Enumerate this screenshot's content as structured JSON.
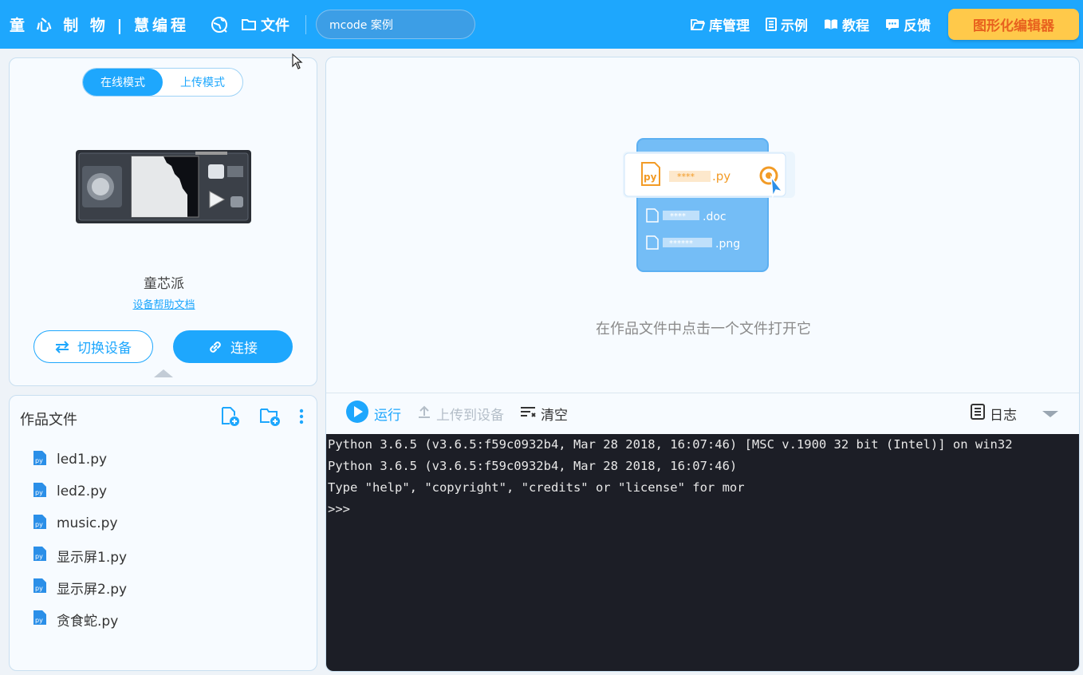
{
  "header": {
    "brand": "童 心 制 物 | 慧编程",
    "file_menu": "文件",
    "search_value": "mcode 案例",
    "nav": [
      {
        "label": "库管理",
        "icon": "folder-open-icon"
      },
      {
        "label": "示例",
        "icon": "list-doc-icon"
      },
      {
        "label": "教程",
        "icon": "book-icon"
      },
      {
        "label": "反馈",
        "icon": "chat-icon"
      }
    ],
    "graphic_editor": "图形化编辑器"
  },
  "device": {
    "modes": [
      "在线模式",
      "上传模式"
    ],
    "active_mode": "在线模式",
    "name": "童芯派",
    "help_link": "设备帮助文档",
    "switch_label": "切换设备",
    "connect_label": "连接"
  },
  "files": {
    "title": "作品文件",
    "items": [
      "led1.py",
      "led2.py",
      "music.py",
      "显示屏1.py",
      "显示屏2.py",
      "贪食蛇.py"
    ]
  },
  "editor": {
    "illustration": {
      "py_mask": "****",
      "py_ext": ".py",
      "doc_mask": "****",
      "doc_ext": ".doc",
      "png_mask": "******",
      "png_ext": ".png"
    },
    "empty_hint": "在作品文件中点击一个文件打开它"
  },
  "console": {
    "run_label": "运行",
    "upload_label": "上传到设备",
    "clear_label": "清空",
    "log_label": "日志",
    "lines": [
      "Python 3.6.5 (v3.6.5:f59c0932b4, Mar 28 2018, 16:07:46) [MSC v.1900 32 bit (Intel)] on win32",
      "Python 3.6.5 (v3.6.5:f59c0932b4, Mar 28 2018, 16:07:46)",
      "Type \"help\", \"copyright\", \"credits\" or \"license\" for mor",
      ">>>"
    ]
  },
  "colors": {
    "primary": "#1ea7fd",
    "accent_button": "#ffc94a",
    "accent_text": "#e8611e",
    "terminal_bg": "#1c1e26"
  }
}
